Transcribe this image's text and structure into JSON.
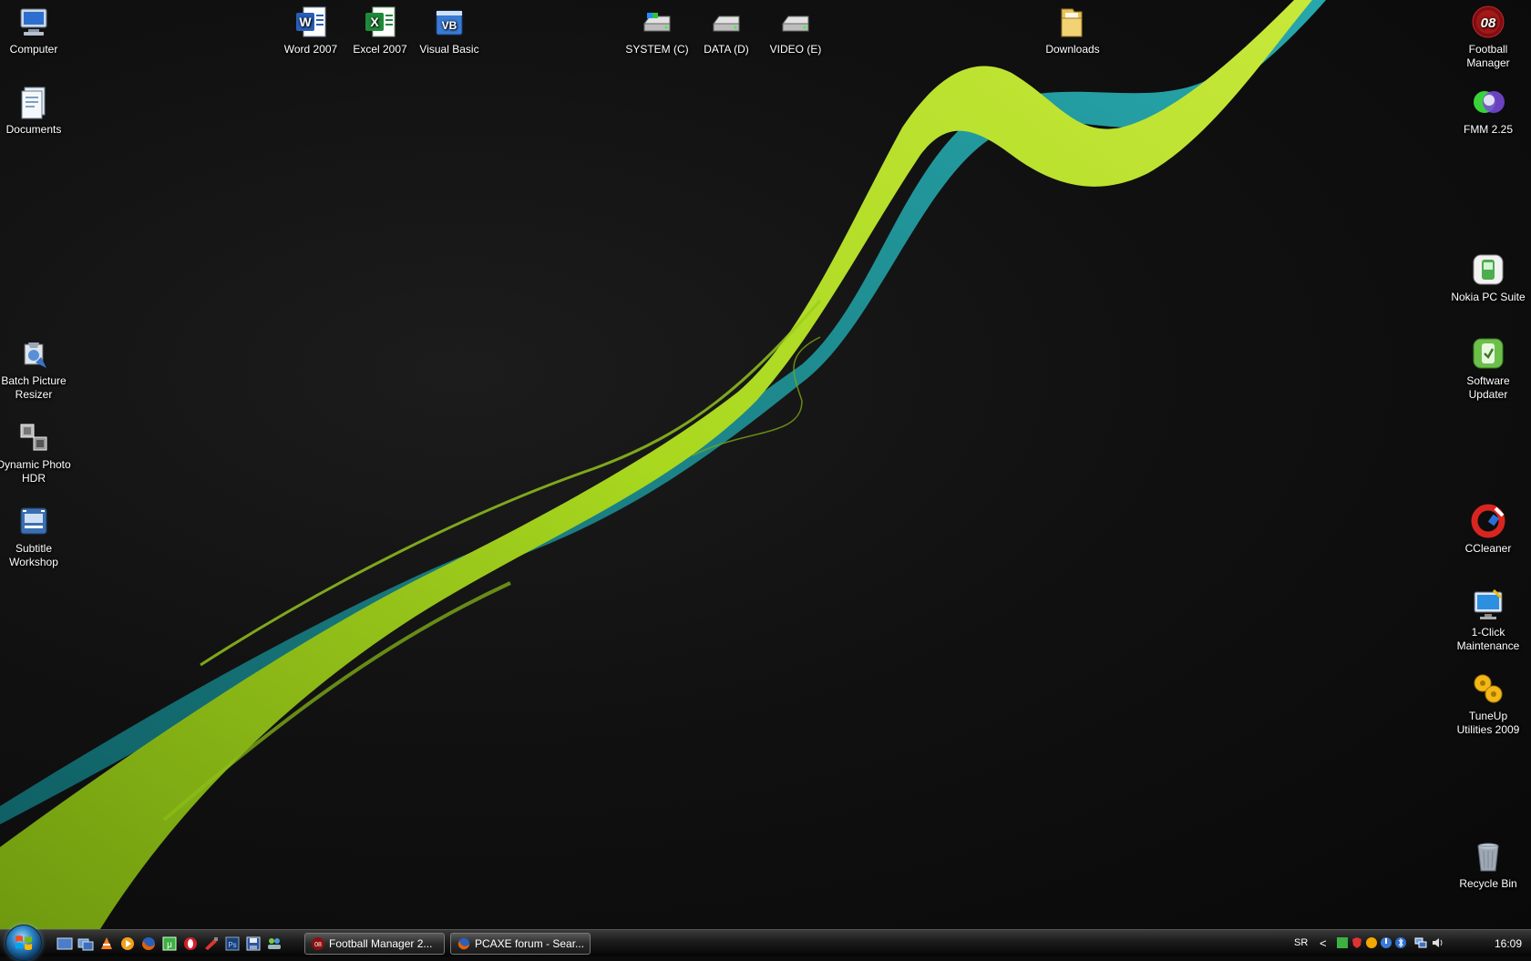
{
  "desktop_icons": {
    "computer": "Computer",
    "documents": "Documents",
    "word": "Word 2007",
    "excel": "Excel 2007",
    "visual_basic": "Visual Basic",
    "system_c": "SYSTEM (C)",
    "data_d": "DATA (D)",
    "video_e": "VIDEO (E)",
    "downloads": "Downloads",
    "football_manager": "Football Manager",
    "fmm": "FMM 2.25",
    "nokia": "Nokia PC Suite",
    "software_updater": "Software Updater",
    "batch_resizer": "Batch Picture Resizer",
    "dynamic_hdr": "Dynamic Photo HDR",
    "subtitle_workshop": "Subtitle Workshop",
    "ccleaner": "CCleaner",
    "one_click": "1-Click Maintenance",
    "tuneup": "TuneUp Utilities 2009",
    "recycle_bin": "Recycle Bin"
  },
  "taskbar": {
    "tasks": [
      {
        "label": "Football Manager 2...",
        "icon": "football-manager-icon"
      },
      {
        "label": "PCAXE forum - Sear...",
        "icon": "firefox-icon"
      }
    ],
    "language": "SR",
    "tray_arrow": "<",
    "clock": "16:09"
  },
  "colors": {
    "wallpaper_green": "#9acd1e",
    "wallpaper_teal": "#1aa3a8",
    "background": "#0c0c0c"
  }
}
